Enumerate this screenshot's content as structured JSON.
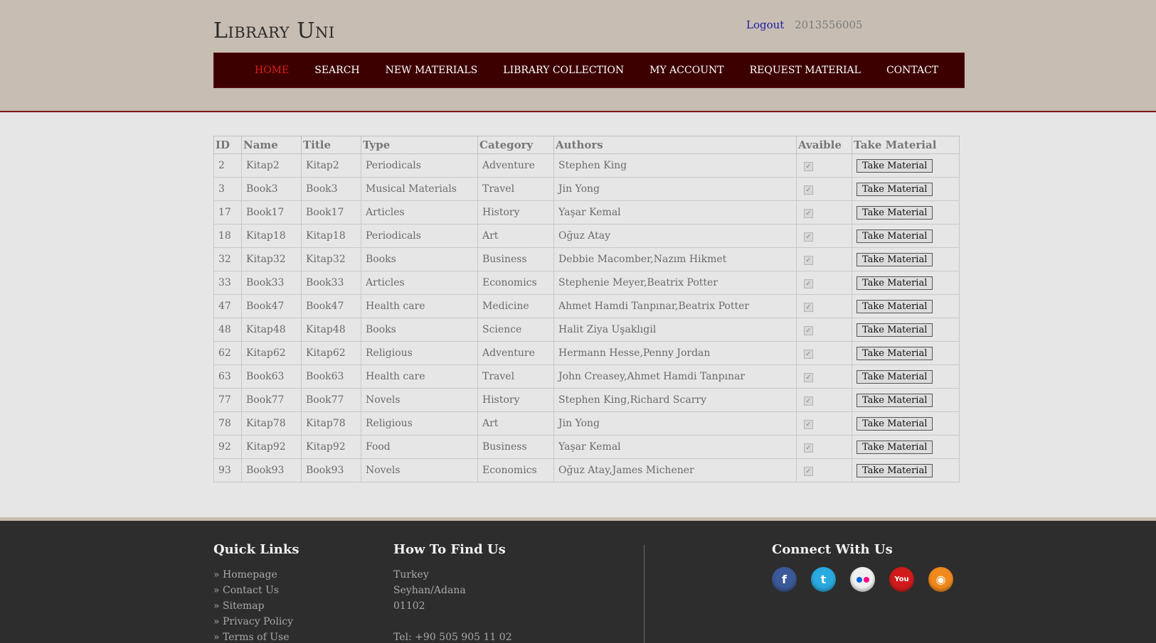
{
  "header": {
    "logo": "Library Uni",
    "logout": "Logout",
    "user_id": "2013556005"
  },
  "nav": [
    {
      "label": "HOME",
      "active": true
    },
    {
      "label": "SEARCH"
    },
    {
      "label": "NEW MATERIALS"
    },
    {
      "label": "LIBRARY COLLECTION"
    },
    {
      "label": "MY ACCOUNT"
    },
    {
      "label": "REQUEST MATERIAL"
    },
    {
      "label": "CONTACT"
    }
  ],
  "table": {
    "columns": [
      "ID",
      "Name",
      "Title",
      "Type",
      "Category",
      "Authors",
      "Avaible",
      "Take Material"
    ],
    "button_label": "Take Material",
    "rows": [
      {
        "id": "2",
        "name": "Kitap2",
        "title": "Kitap2",
        "type": "Periodicals",
        "category": "Adventure",
        "authors": "Stephen King",
        "available": true
      },
      {
        "id": "3",
        "name": "Book3",
        "title": "Book3",
        "type": "Musical Materials",
        "category": "Travel",
        "authors": "Jin Yong",
        "available": true
      },
      {
        "id": "17",
        "name": "Book17",
        "title": "Book17",
        "type": "Articles",
        "category": "History",
        "authors": "Yaşar Kemal",
        "available": true
      },
      {
        "id": "18",
        "name": "Kitap18",
        "title": "Kitap18",
        "type": "Periodicals",
        "category": "Art",
        "authors": "Oğuz Atay",
        "available": true
      },
      {
        "id": "32",
        "name": "Kitap32",
        "title": "Kitap32",
        "type": "Books",
        "category": "Business",
        "authors": "Debbie Macomber,Nazım Hikmet",
        "available": true
      },
      {
        "id": "33",
        "name": "Book33",
        "title": "Book33",
        "type": "Articles",
        "category": "Economics",
        "authors": "Stephenie Meyer,Beatrix Potter",
        "available": true
      },
      {
        "id": "47",
        "name": "Book47",
        "title": "Book47",
        "type": "Health care",
        "category": "Medicine",
        "authors": "Ahmet Hamdi Tanpınar,Beatrix Potter",
        "available": true
      },
      {
        "id": "48",
        "name": "Kitap48",
        "title": "Kitap48",
        "type": "Books",
        "category": "Science",
        "authors": "Halit Ziya Uşaklıgil",
        "available": true
      },
      {
        "id": "62",
        "name": "Kitap62",
        "title": "Kitap62",
        "type": "Religious",
        "category": "Adventure",
        "authors": "Hermann Hesse,Penny Jordan",
        "available": true
      },
      {
        "id": "63",
        "name": "Book63",
        "title": "Book63",
        "type": "Health care",
        "category": "Travel",
        "authors": "John Creasey,Ahmet Hamdi Tanpınar",
        "available": true
      },
      {
        "id": "77",
        "name": "Book77",
        "title": "Book77",
        "type": "Novels",
        "category": "History",
        "authors": "Stephen King,Richard Scarry",
        "available": true
      },
      {
        "id": "78",
        "name": "Kitap78",
        "title": "Kitap78",
        "type": "Religious",
        "category": "Art",
        "authors": "Jin Yong",
        "available": true
      },
      {
        "id": "92",
        "name": "Kitap92",
        "title": "Kitap92",
        "type": "Food",
        "category": "Business",
        "authors": "Yaşar Kemal",
        "available": true
      },
      {
        "id": "93",
        "name": "Book93",
        "title": "Book93",
        "type": "Novels",
        "category": "Economics",
        "authors": "Oğuz Atay,James Michener",
        "available": true
      }
    ]
  },
  "footer": {
    "quick_links_title": "Quick Links",
    "quick_links": [
      "» Homepage",
      "» Contact Us",
      "» Sitemap",
      "» Privacy Policy",
      "» Terms of Use"
    ],
    "find_us_title": "How To Find Us",
    "address": [
      "Turkey",
      "Seyhan/Adana",
      "01102"
    ],
    "tel": "Tel: +90 505 905 11 02",
    "connect_title": "Connect With Us",
    "social": [
      {
        "icon": "facebook-icon",
        "glyph": "f",
        "color": "#3b5998"
      },
      {
        "icon": "twitter-icon",
        "glyph": "t",
        "color": "#2aa9e0"
      },
      {
        "icon": "flickr-icon",
        "glyph": "••",
        "color": "#f0f0f0"
      },
      {
        "icon": "youtube-icon",
        "glyph": "You",
        "color": "#d11b1b"
      },
      {
        "icon": "rss-icon",
        "glyph": "◉",
        "color": "#f08a1c"
      }
    ]
  }
}
